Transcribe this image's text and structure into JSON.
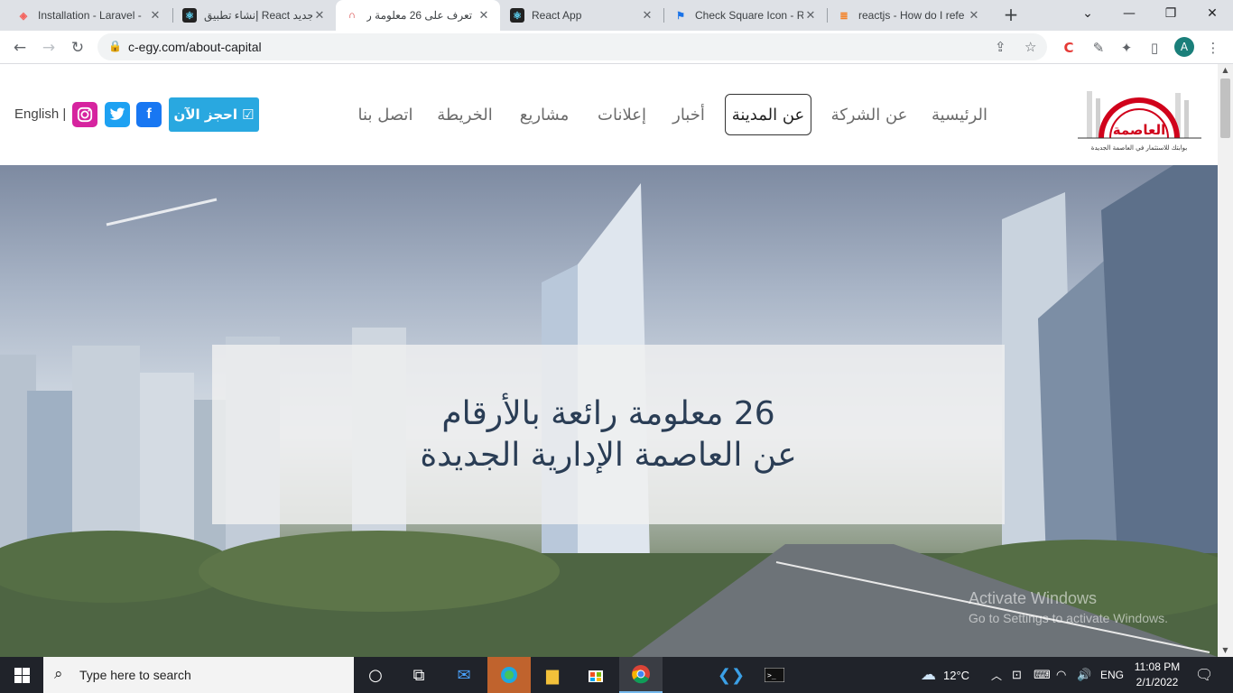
{
  "browser": {
    "tabs": [
      {
        "title": "Installation - Laravel -",
        "icon": "laravel-icon",
        "color": "#f4645f"
      },
      {
        "title": "إنشاء تطبيق React جديد",
        "icon": "react-icon",
        "color": "#61dafb"
      },
      {
        "title": "تعرف على 26 معلومة ر",
        "icon": "site-favicon",
        "color": "#d32f2f"
      },
      {
        "title": "React App",
        "icon": "react-icon",
        "color": "#61dafb"
      },
      {
        "title": "Check Square Icon - R",
        "icon": "flag-icon",
        "color": "#1a73e8"
      },
      {
        "title": "reactjs - How do I refe",
        "icon": "stackoverflow-icon",
        "color": "#f48024"
      }
    ],
    "active_tab": 2,
    "url": "c-egy.com/about-capital",
    "profile_initial": "A"
  },
  "site": {
    "logo_text": "العاصمة",
    "logo_tagline": "بوابتك للاستثمار في العاصمة الجديدة",
    "nav": [
      {
        "label": "الرئيسية"
      },
      {
        "label": "عن الشركة"
      },
      {
        "label": "عن المدينة"
      },
      {
        "label": "أخبار"
      },
      {
        "label": "إعلانات"
      },
      {
        "label": "مشاريع"
      },
      {
        "label": "الخريطة"
      },
      {
        "label": "اتصل بنا"
      }
    ],
    "active_nav": "عن المدينة",
    "book_button": "احجز الآن",
    "language": "English |",
    "hero_line1": "26 معلومة رائعة بالأرقام",
    "hero_line2": "عن العاصمة الإدارية الجديدة",
    "watermark_title": "Activate Windows",
    "watermark_sub": "Go to Settings to activate Windows."
  },
  "taskbar": {
    "search_placeholder": "Type here to search",
    "weather": "12°C",
    "language": "ENG",
    "time": "11:08 PM",
    "date": "2/1/2022"
  }
}
